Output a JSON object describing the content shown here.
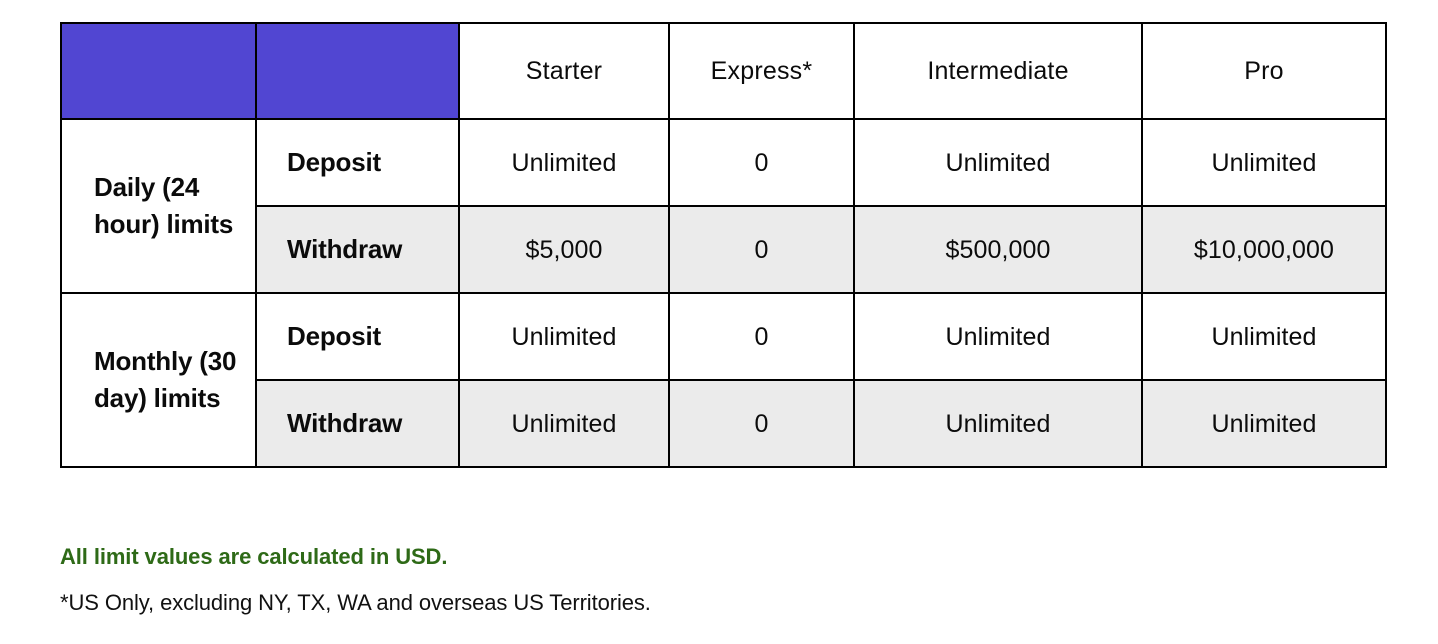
{
  "table": {
    "headers": [
      "",
      "",
      "Starter",
      "Express*",
      "Intermediate",
      "Pro"
    ],
    "groups": [
      {
        "label": "Daily (24 hour) limits",
        "rows": [
          {
            "action": "Deposit",
            "shaded": false,
            "values": [
              "Unlimited",
              "0",
              "Unlimited",
              "Unlimited"
            ]
          },
          {
            "action": "Withdraw",
            "shaded": true,
            "values": [
              "$5,000",
              "0",
              "$500,000",
              "$10,000,000"
            ]
          }
        ]
      },
      {
        "label": "Monthly (30 day) limits",
        "rows": [
          {
            "action": "Deposit",
            "shaded": false,
            "values": [
              "Unlimited",
              "0",
              "Unlimited",
              "Unlimited"
            ]
          },
          {
            "action": "Withdraw",
            "shaded": true,
            "values": [
              "Unlimited",
              "0",
              "Unlimited",
              "Unlimited"
            ]
          }
        ]
      }
    ]
  },
  "notes": {
    "currency_note": "All limit values are calculated in USD.",
    "region_note": "*US Only, excluding NY, TX, WA and overseas US Territories."
  },
  "colors": {
    "header_background": "#5146D2",
    "header_text": "#EEEAF8",
    "shaded_row": "#EBEBEB",
    "note_green": "#2E6A17",
    "border": "#000000",
    "body_text": "#0B0B0B"
  }
}
